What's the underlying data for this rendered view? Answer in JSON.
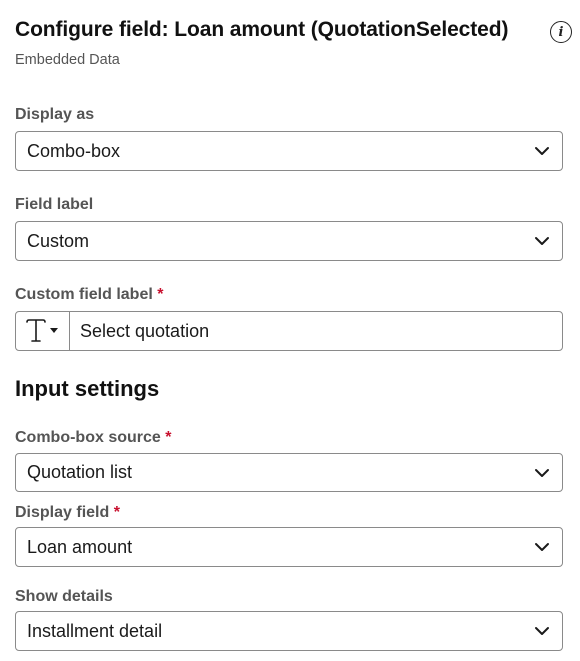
{
  "header": {
    "title": "Configure field: Loan amount (QuotationSelected)",
    "subtitle": "Embedded Data",
    "info_icon": "info-icon",
    "info_glyph": "i"
  },
  "display_as": {
    "label": "Display as",
    "value": "Combo-box"
  },
  "field_label": {
    "label": "Field label",
    "value": "Custom"
  },
  "custom_field_label": {
    "label": "Custom field label",
    "required_mark": "*",
    "type_icon": "text-type-icon",
    "value": "Select quotation"
  },
  "input_settings": {
    "title": "Input settings",
    "combo_source": {
      "label": "Combo-box source",
      "required_mark": "*",
      "value": "Quotation list"
    },
    "display_field": {
      "label": "Display field",
      "required_mark": "*",
      "value": "Loan amount"
    },
    "show_details": {
      "label": "Show details",
      "value": "Installment detail"
    }
  },
  "colors": {
    "required": "#c8102e",
    "border": "#8a8a8a",
    "label": "#555555"
  }
}
